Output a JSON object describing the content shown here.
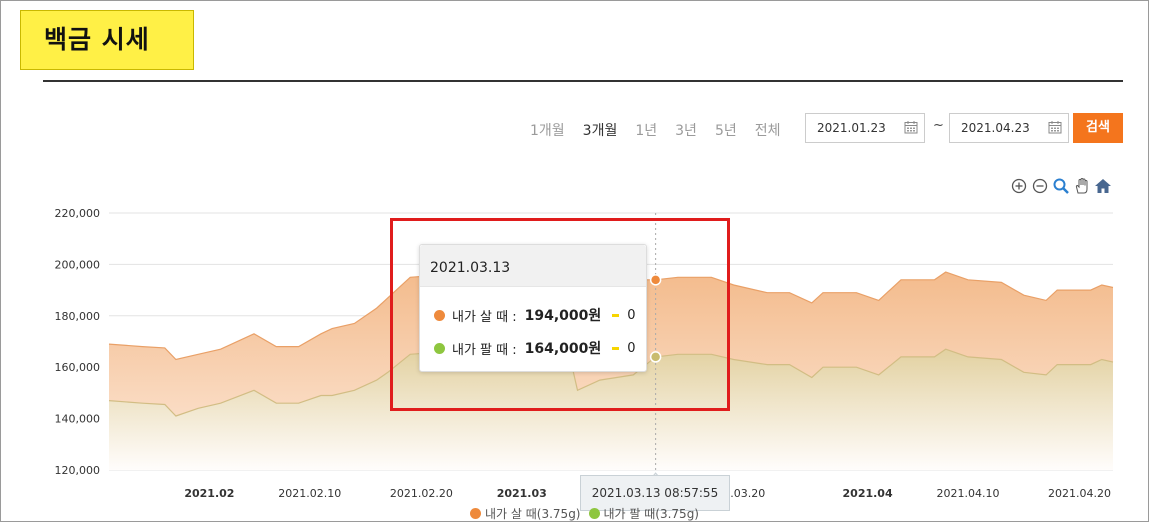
{
  "page": {
    "title": "백금 시세"
  },
  "controls": {
    "periods": [
      "1개월",
      "3개월",
      "1년",
      "3년",
      "5년",
      "전체"
    ],
    "active_period": "3개월",
    "start_date": "2021.01.23",
    "tilde": "~",
    "end_date": "2021.04.23",
    "search_label": "검색"
  },
  "tooltip": {
    "date": "2021.03.13",
    "rows": [
      {
        "label": "내가 살 때 :",
        "value": "194,000원",
        "change": "0",
        "color": "#ee8a3c"
      },
      {
        "label": "내가 팔 때 :",
        "value": "164,000원",
        "change": "0",
        "color": "#8ec63f"
      }
    ]
  },
  "crosshair_label": "2021.03.13 08:57:55",
  "chart_data": {
    "type": "area",
    "title": "",
    "xlabel": "",
    "ylabel": "",
    "ylim": [
      120000,
      220000
    ],
    "yticks": [
      220000,
      200000,
      180000,
      160000,
      140000,
      120000
    ],
    "ytick_labels": [
      "220,000",
      "200,000",
      "180,000",
      "160,000",
      "140,000",
      "120,000"
    ],
    "xticks": [
      {
        "date": "2021-02-01",
        "label": "2021.02",
        "bold": true
      },
      {
        "date": "2021-02-10",
        "label": "2021.02.10",
        "bold": false
      },
      {
        "date": "2021-02-20",
        "label": "2021.02.20",
        "bold": false
      },
      {
        "date": "2021-03-01",
        "label": "2021.03",
        "bold": true
      },
      {
        "date": "2021-03-20",
        "label": "2021.03.20",
        "bold": false
      },
      {
        "date": "2021-04-01",
        "label": "2021.04",
        "bold": true
      },
      {
        "date": "2021-04-10",
        "label": "2021.04.10",
        "bold": false
      },
      {
        "date": "2021-04-20",
        "label": "2021.04.20",
        "bold": false
      }
    ],
    "xlim": [
      "2021-01-23",
      "2021-04-23"
    ],
    "grid": true,
    "legend_position": "bottom",
    "highlight_date": "2021-03-13",
    "series": [
      {
        "name": "내가 살 때(3.75g)",
        "color": "#ee8a3c",
        "points": [
          [
            "2021-01-23",
            169000
          ],
          [
            "2021-01-26",
            168000
          ],
          [
            "2021-01-28",
            167500
          ],
          [
            "2021-01-29",
            163000
          ],
          [
            "2021-01-31",
            165000
          ],
          [
            "2021-02-02",
            167000
          ],
          [
            "2021-02-05",
            173000
          ],
          [
            "2021-02-07",
            168000
          ],
          [
            "2021-02-09",
            168000
          ],
          [
            "2021-02-11",
            173000
          ],
          [
            "2021-02-12",
            175000
          ],
          [
            "2021-02-14",
            177000
          ],
          [
            "2021-02-16",
            183000
          ],
          [
            "2021-02-17",
            187000
          ],
          [
            "2021-02-19",
            195000
          ],
          [
            "2021-02-22",
            196000
          ],
          [
            "2021-02-24",
            198000
          ],
          [
            "2021-02-25",
            207000
          ],
          [
            "2021-02-27",
            197000
          ],
          [
            "2021-03-01",
            199000
          ],
          [
            "2021-03-04",
            200000
          ],
          [
            "2021-03-07",
            199000
          ],
          [
            "2021-03-09",
            194000
          ],
          [
            "2021-03-11",
            194000
          ],
          [
            "2021-03-13",
            194000
          ],
          [
            "2021-03-15",
            195000
          ],
          [
            "2021-03-18",
            195000
          ],
          [
            "2021-03-20",
            192000
          ],
          [
            "2021-03-23",
            189000
          ],
          [
            "2021-03-25",
            189000
          ],
          [
            "2021-03-27",
            185000
          ],
          [
            "2021-03-28",
            189000
          ],
          [
            "2021-03-31",
            189000
          ],
          [
            "2021-04-02",
            186000
          ],
          [
            "2021-04-04",
            194000
          ],
          [
            "2021-04-07",
            194000
          ],
          [
            "2021-04-08",
            197000
          ],
          [
            "2021-04-10",
            194000
          ],
          [
            "2021-04-13",
            193000
          ],
          [
            "2021-04-15",
            188000
          ],
          [
            "2021-04-17",
            186000
          ],
          [
            "2021-04-18",
            190000
          ],
          [
            "2021-04-20",
            190000
          ],
          [
            "2021-04-21",
            190000
          ],
          [
            "2021-04-22",
            192000
          ],
          [
            "2021-04-23",
            191000
          ]
        ]
      },
      {
        "name": "내가 팔 때(3.75g)",
        "color": "#8ec63f",
        "points": [
          [
            "2021-01-23",
            147000
          ],
          [
            "2021-01-26",
            146000
          ],
          [
            "2021-01-28",
            145500
          ],
          [
            "2021-01-29",
            141000
          ],
          [
            "2021-01-31",
            144000
          ],
          [
            "2021-02-02",
            146000
          ],
          [
            "2021-02-05",
            151000
          ],
          [
            "2021-02-07",
            146000
          ],
          [
            "2021-02-09",
            146000
          ],
          [
            "2021-02-11",
            149000
          ],
          [
            "2021-02-12",
            149000
          ],
          [
            "2021-02-14",
            151000
          ],
          [
            "2021-02-16",
            155000
          ],
          [
            "2021-02-17",
            158000
          ],
          [
            "2021-02-19",
            165000
          ],
          [
            "2021-02-22",
            166000
          ],
          [
            "2021-02-24",
            168000
          ],
          [
            "2021-02-25",
            175000
          ],
          [
            "2021-02-27",
            168000
          ],
          [
            "2021-03-01",
            169000
          ],
          [
            "2021-03-04",
            170000
          ],
          [
            "2021-03-05",
            170000
          ],
          [
            "2021-03-06",
            151000
          ],
          [
            "2021-03-08",
            155000
          ],
          [
            "2021-03-11",
            157000
          ],
          [
            "2021-03-13",
            164000
          ],
          [
            "2021-03-15",
            165000
          ],
          [
            "2021-03-18",
            165000
          ],
          [
            "2021-03-20",
            163000
          ],
          [
            "2021-03-23",
            161000
          ],
          [
            "2021-03-25",
            161000
          ],
          [
            "2021-03-27",
            156000
          ],
          [
            "2021-03-28",
            160000
          ],
          [
            "2021-03-31",
            160000
          ],
          [
            "2021-04-02",
            157000
          ],
          [
            "2021-04-04",
            164000
          ],
          [
            "2021-04-07",
            164000
          ],
          [
            "2021-04-08",
            167000
          ],
          [
            "2021-04-10",
            164000
          ],
          [
            "2021-04-13",
            163000
          ],
          [
            "2021-04-15",
            158000
          ],
          [
            "2021-04-17",
            157000
          ],
          [
            "2021-04-18",
            161000
          ],
          [
            "2021-04-20",
            161000
          ],
          [
            "2021-04-21",
            161000
          ],
          [
            "2021-04-22",
            163000
          ],
          [
            "2021-04-23",
            162000
          ]
        ]
      }
    ]
  }
}
